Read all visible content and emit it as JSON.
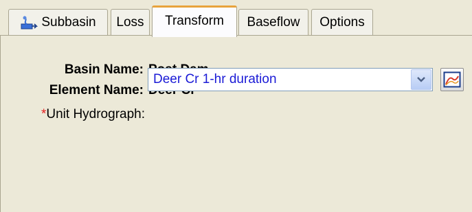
{
  "tabs": [
    {
      "label": "Subbasin",
      "icon": "subbasin-icon"
    },
    {
      "label": "Loss"
    },
    {
      "label": "Transform",
      "active": true
    },
    {
      "label": "Baseflow"
    },
    {
      "label": "Options"
    }
  ],
  "fields": {
    "basin_name_label": "Basin Name:",
    "basin_name_value": "Post Dam",
    "element_name_label": "Element Name:",
    "element_name_value": "Deer Cr",
    "required_marker": "*",
    "unit_hydrograph_label": "Unit Hydrograph:",
    "unit_hydrograph_value": "Deer Cr 1-hr duration"
  },
  "icons": {
    "dropdown": "chevron-down-icon",
    "graph": "graph-icon"
  },
  "colors": {
    "accent_tab_top": "#e8a33b",
    "required": "#e52020",
    "combo_text": "#1a1ad6",
    "panel_bg": "#ece9d8"
  }
}
